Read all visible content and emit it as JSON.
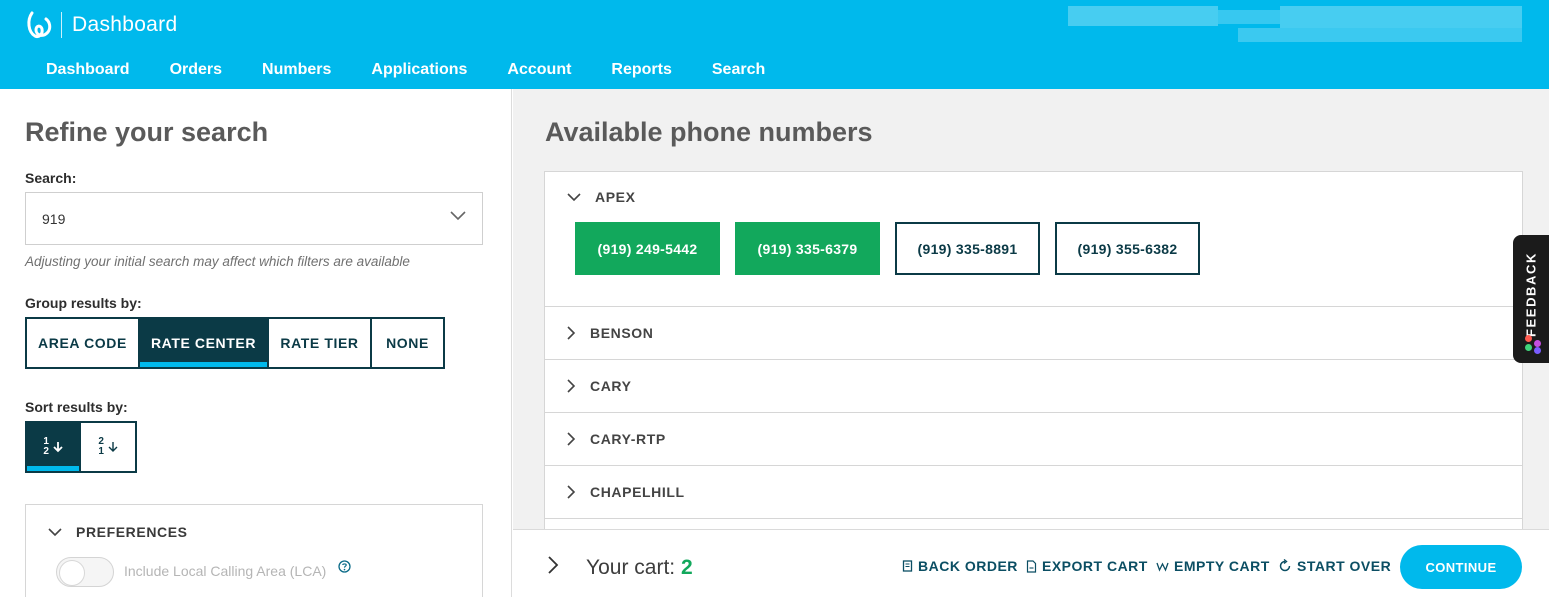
{
  "header": {
    "brand_title": "Dashboard",
    "nav": [
      "Dashboard",
      "Orders",
      "Numbers",
      "Applications",
      "Account",
      "Reports",
      "Search"
    ]
  },
  "refine": {
    "title": "Refine your search",
    "search_label": "Search:",
    "search_value": "919",
    "hint": "Adjusting your initial search may affect which filters are available",
    "group_label": "Group results by:",
    "group_options": [
      "AREA CODE",
      "RATE CENTER",
      "RATE TIER",
      "NONE"
    ],
    "group_selected": "RATE CENTER",
    "sort_label": "Sort results by:",
    "sort_asc": [
      "1",
      "2"
    ],
    "sort_desc": [
      "2",
      "1"
    ],
    "preferences_title": "PREFERENCES",
    "lca_label": "Include Local Calling Area (LCA)"
  },
  "results": {
    "title": "Available phone numbers",
    "groups": [
      {
        "name": "APEX",
        "open": true,
        "numbers": [
          {
            "number": "(919) 249-5442",
            "selected": true
          },
          {
            "number": "(919) 335-6379",
            "selected": true
          },
          {
            "number": "(919) 335-8891",
            "selected": false
          },
          {
            "number": "(919) 355-6382",
            "selected": false
          }
        ]
      },
      {
        "name": "BENSON",
        "open": false
      },
      {
        "name": "CARY",
        "open": false
      },
      {
        "name": "CARY-RTP",
        "open": false
      },
      {
        "name": "CHAPELHILL",
        "open": false
      }
    ]
  },
  "cart": {
    "label": "Your cart:",
    "count": "2",
    "back_order": "BACK ORDER",
    "export_cart": "EXPORT CART",
    "empty_cart": "EMPTY CART",
    "start_over": "START OVER",
    "continue": "CONTINUE"
  },
  "feedback": {
    "label": "FEEDBACK"
  },
  "colors": {
    "header_blue": "#00b9ec",
    "dark_teal": "#0b3a46",
    "selected_green": "#12a85c"
  }
}
